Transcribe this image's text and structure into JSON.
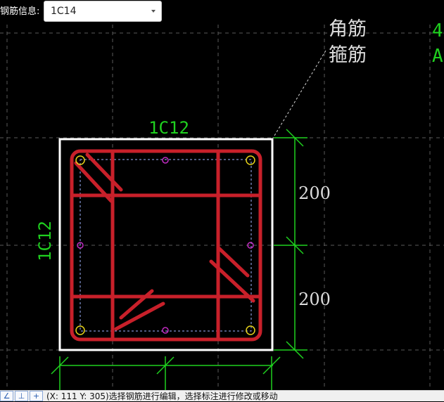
{
  "toolbar": {
    "rebar_info_label": "钢筋信息:",
    "rebar_select_value": "1C14"
  },
  "legend": {
    "corner_rebar": "角筋",
    "stirrup": "箍筋",
    "right_cut_1": "4",
    "right_cut_2": "A"
  },
  "section": {
    "top_rebar_label": "1C12",
    "side_rebar_label": "1C12",
    "dim_upper": "200",
    "dim_lower": "200"
  },
  "statusbar": {
    "button_1": "∠",
    "button_2": "⊥",
    "button_3": "+",
    "hint": "(X: 111 Y: 305)选择钢筋进行编辑，选择标注进行修改或移动"
  },
  "colors": {
    "background": "#000000",
    "grid": "#5a5a5a",
    "outline": "#ffffff",
    "rebar": "#c8202a",
    "dimension": "#1fd11f",
    "annotation_text": "#dddddd",
    "corner_point": "#e6d21a",
    "mid_point": "#c22bc2"
  }
}
